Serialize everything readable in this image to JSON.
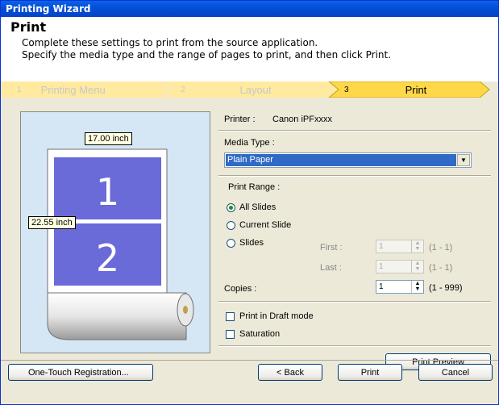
{
  "window": {
    "title": "Printing Wizard"
  },
  "header": {
    "title": "Print",
    "desc1": "Complete these settings to print from the source application.",
    "desc2": "Specify the media type and the range of pages to print, and then click Print."
  },
  "steps": [
    {
      "num": "1",
      "label": "Printing Menu",
      "active": false
    },
    {
      "num": "2",
      "label": "Layout",
      "active": false
    },
    {
      "num": "3",
      "label": "Print",
      "active": true
    }
  ],
  "preview": {
    "width_label": "17.00 inch",
    "height_label": "22.55 inch",
    "page1": "1",
    "page2": "2"
  },
  "settings": {
    "printer_label": "Printer :",
    "printer_value": "Canon iPFxxxx",
    "media_type_label": "Media Type :",
    "media_type_value": "Plain Paper",
    "print_range_label": "Print Range :",
    "radio_all": "All Slides",
    "radio_current": "Current Slide",
    "radio_slides": "Slides",
    "first_label": "First :",
    "first_value": "1",
    "first_range": "(1 - 1)",
    "last_label": "Last :",
    "last_value": "1",
    "last_range": "(1 - 1)",
    "copies_label": "Copies :",
    "copies_value": "1",
    "copies_range": "(1 - 999)",
    "draft_label": "Print in Draft mode",
    "saturation_label": "Saturation",
    "preview_button": "Print Preview"
  },
  "footer": {
    "onetouch": "One-Touch Registration...",
    "back": "< Back",
    "print": "Print",
    "cancel": "Cancel"
  },
  "colors": {
    "title_bar": "#0a4fd8",
    "step_active": "#ffd84a",
    "step_inactive": "#ffeaa0",
    "page_blue": "#6a6ad8"
  }
}
